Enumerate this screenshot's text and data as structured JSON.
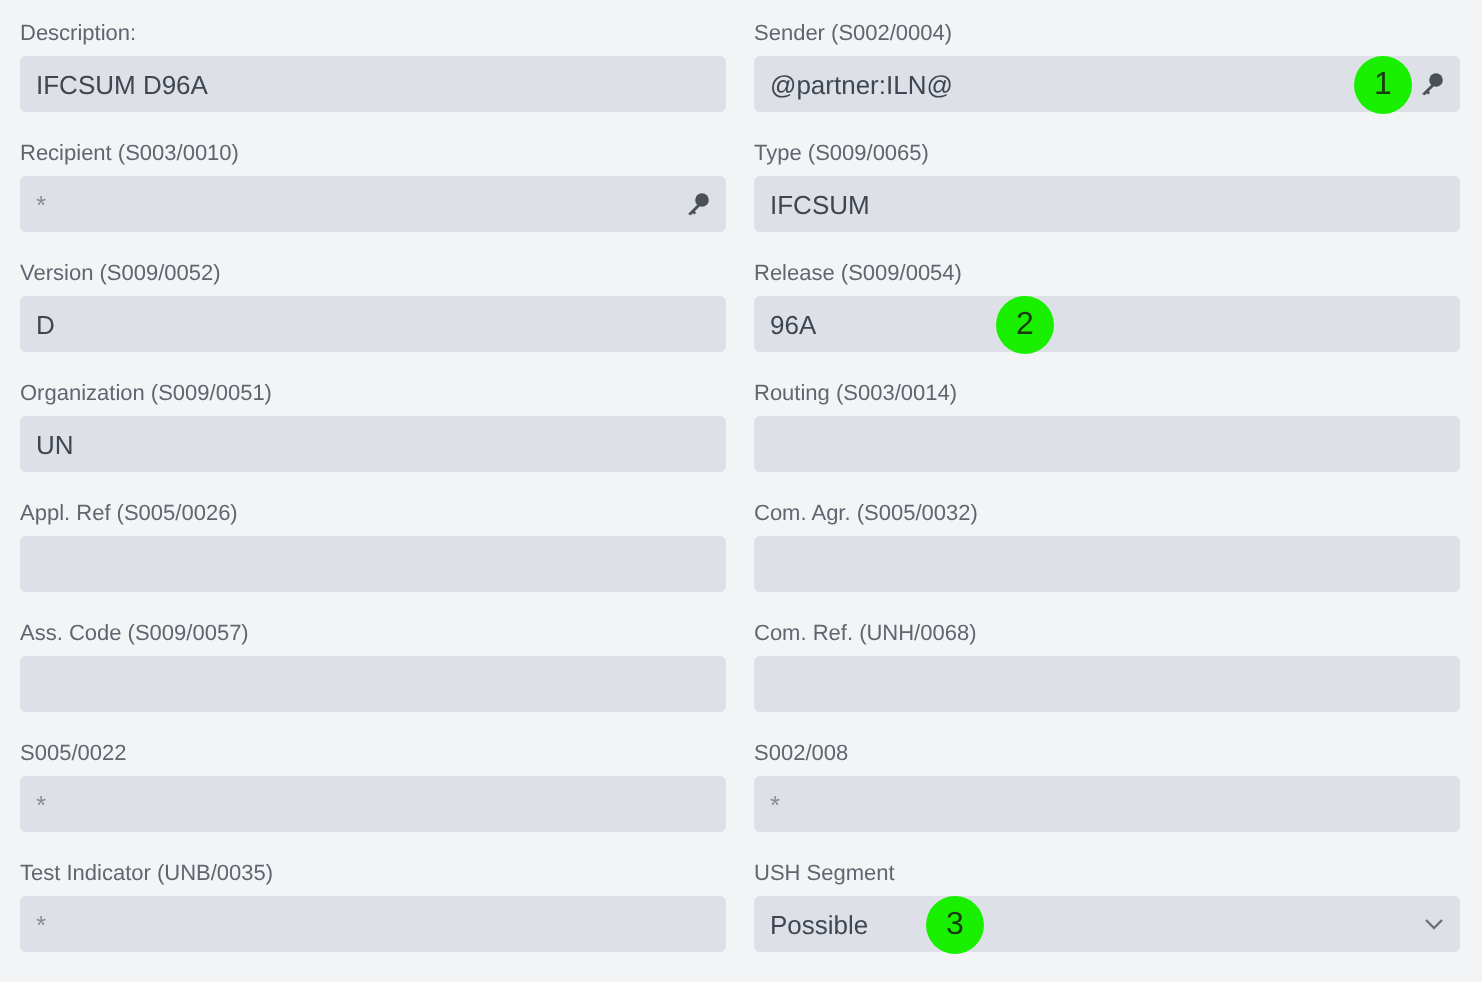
{
  "fields": [
    {
      "label": "Description:",
      "kind": "text",
      "value": "IFCSUM D96A"
    },
    {
      "label": "Sender (S002/0004)",
      "kind": "text",
      "value": "@partner:ILN@",
      "lookup": true,
      "badge": "1"
    },
    {
      "label": "Recipient (S003/0010)",
      "kind": "text",
      "placeholder": "*",
      "lookup": true
    },
    {
      "label": "Type (S009/0065)",
      "kind": "text",
      "value": "IFCSUM"
    },
    {
      "label": "Version (S009/0052)",
      "kind": "text",
      "value": "D"
    },
    {
      "label": "Release (S009/0054)",
      "kind": "text",
      "value": "96A",
      "badge": "2"
    },
    {
      "label": "Organization (S009/0051)",
      "kind": "text",
      "value": "UN"
    },
    {
      "label": "Routing (S003/0014)",
      "kind": "text"
    },
    {
      "label": "Appl. Ref (S005/0026)",
      "kind": "text"
    },
    {
      "label": "Com. Agr. (S005/0032)",
      "kind": "text"
    },
    {
      "label": "Ass. Code (S009/0057)",
      "kind": "text"
    },
    {
      "label": "Com. Ref. (UNH/0068)",
      "kind": "text"
    },
    {
      "label": "S005/0022",
      "kind": "text",
      "placeholder": "*"
    },
    {
      "label": "S002/008",
      "kind": "text",
      "placeholder": "*"
    },
    {
      "label": "Test Indicator (UNB/0035)",
      "kind": "text",
      "placeholder": "*"
    },
    {
      "label": "USH Segment",
      "kind": "select",
      "value": "Possible",
      "badge": "3"
    }
  ]
}
